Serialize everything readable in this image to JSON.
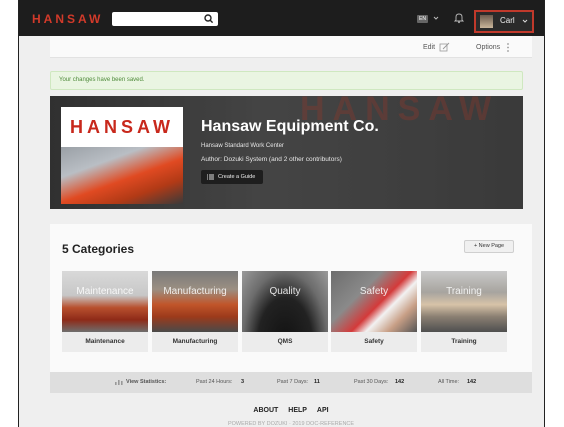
{
  "header": {
    "logo": "HANSAW",
    "lang": "EN",
    "user_name": "Carl"
  },
  "subbar": {
    "edit_label": "Edit",
    "options_label": "Options"
  },
  "alert": {
    "message": "Your changes have been saved."
  },
  "banner": {
    "thumb_brand": "HANSAW",
    "title": "Hansaw Equipment Co.",
    "subtitle": "Hansaw Standard Work Center",
    "author": "Author: Dozuki System (and 2 other contributors)",
    "create_label": "Create a Guide"
  },
  "categories": {
    "heading": "5 Categories",
    "new_page_label": "+ New Page",
    "items": [
      {
        "overlay": "Maintenance",
        "caption": "Maintenance"
      },
      {
        "overlay": "Manufacturing",
        "caption": "Manufacturing"
      },
      {
        "overlay": "Quality",
        "caption": "QMS"
      },
      {
        "overlay": "Safety",
        "caption": "Safety"
      },
      {
        "overlay": "Training",
        "caption": "Training"
      }
    ]
  },
  "stats": {
    "view_label": "View Statistics:",
    "past24_label": "Past 24 Hours:",
    "past24_value": "3",
    "past7_label": "Past 7 Days:",
    "past7_value": "11",
    "past30_label": "Past 30 Days:",
    "past30_value": "142",
    "alltime_label": "All Time:",
    "alltime_value": "142"
  },
  "footer": {
    "links": [
      "ABOUT",
      "HELP",
      "API"
    ],
    "powered": "POWERED BY DOZUKI · 2019 DOC-REFERENCE"
  }
}
